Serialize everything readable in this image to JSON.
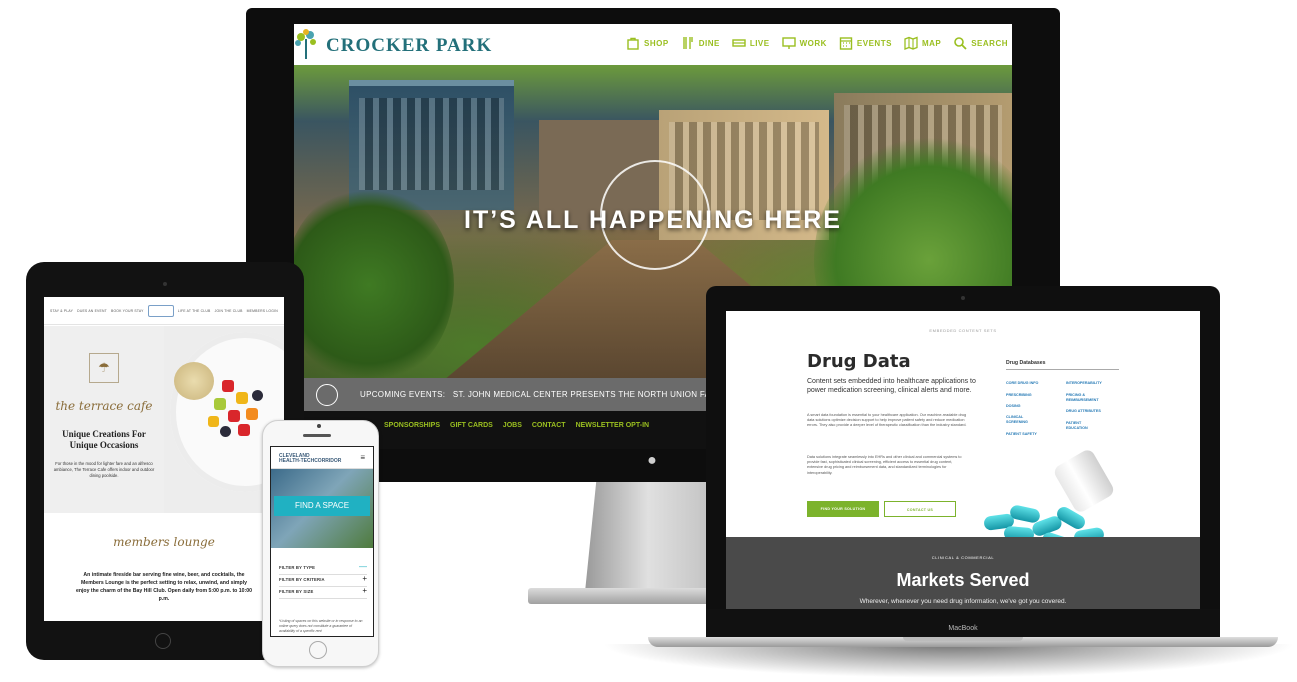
{
  "desktop": {
    "brand": "CROCKER PARK",
    "nav": [
      {
        "label": "SHOP",
        "icon": "shopping-bag-icon"
      },
      {
        "label": "DINE",
        "icon": "utensils-icon"
      },
      {
        "label": "LIVE",
        "icon": "bed-icon"
      },
      {
        "label": "WORK",
        "icon": "monitor-icon"
      },
      {
        "label": "EVENTS",
        "icon": "calendar-icon"
      },
      {
        "label": "MAP",
        "icon": "map-icon"
      },
      {
        "label": "SEARCH",
        "icon": "search-icon"
      }
    ],
    "hero_title": "IT’S ALL HAPPENING HERE",
    "events_label": "UPCOMING EVENTS:",
    "events_text": "ST. JOHN MEDICAL CENTER PRESENTS THE NORTH UNION FARMERS MARKET —",
    "footer_links": [
      "SPONSORSHIPS",
      "GIFT CARDS",
      "JOBS",
      "CONTACT",
      "NEWSLETTER OPT-IN"
    ],
    "accent_color": "#9abf20",
    "brand_color": "#23707a"
  },
  "tablet": {
    "nav": [
      "STAY & PLAY",
      "DUES AN EVENT",
      "BOOK YOUR STAY",
      "LIFE AT THE CLUB",
      "JOIN THE CLUB",
      "MEMBERS LOGIN"
    ],
    "cafe_script": "the terrace cafe",
    "cafe_heading_line1": "Unique Creations For",
    "cafe_heading_line2": "Unique Occasions",
    "cafe_body": "For those in the mood for lighter fare and an alfresco ambiance, The Terrace Cafe offers indoor and outdoor dining poolside.",
    "lounge_script": "members lounge",
    "lounge_body": "An intimate fireside bar serving fine wine, beer, and cocktails, the Members Lounge is the perfect setting to relax, unwind, and simply enjoy the charm of the Bay Hill Club. Open daily from 5:00 p.m. to 10:00 p.m.",
    "script_color": "#8a6d3a"
  },
  "phone": {
    "logo_line1": "CLEVELAND",
    "logo_line2": "HEALTH-TECH",
    "logo_line3": "CORRIDOR",
    "find_button": "FIND A SPACE",
    "filters": [
      {
        "label": "FILTER BY TYPE",
        "toggle": "—"
      },
      {
        "label": "FILTER BY CRITERIA",
        "toggle": "+"
      },
      {
        "label": "FILTER BY SIZE",
        "toggle": "+"
      }
    ],
    "note": "*Listing of spaces on this website or in response to an online query does not constitute a guarantee of availability of a specific rent",
    "accent_color": "#20b1c2"
  },
  "laptop": {
    "eyebrow": "EMBEDDED CONTENT SETS",
    "title": "Drug Data",
    "subtitle": "Content sets embedded into healthcare applications to power medication screening, clinical alerts and more.",
    "para1": "A smart data foundation is essential to your healthcare application. Our machine-readable drug data solutions optimize decision support to help improve patient safety and reduce medication errors. They also provide a deeper level of therapeutic classification than the industry standard.",
    "para2": "Data solutions integrate seamlessly into EHRs and other clinical and commercial systems to provide fast, sophisticated clinical screening, efficient access to essential drug content, extensive drug pricing and reimbursement data, and standardized terminologies for interoperability.",
    "primary_button": "FIND YOUR SOLUTION",
    "secondary_button": "CONTACT US",
    "side_title": "Drug Databases",
    "side_col1": [
      "CORE DRUG INFO",
      "PRESCRIBING",
      "DOSING",
      "CLINICAL SCREENING",
      "PATIENT SAFETY"
    ],
    "side_col2": [
      "INTEROPERABILITY",
      "PRICING & REIMBURSEMENT",
      "DRUG ATTRIBUTES",
      "PATIENT EDUCATION"
    ],
    "band_eyebrow": "CLINICAL & COMMERCIAL",
    "band_title": "Markets Served",
    "band_sub": "Wherever, whenever you need drug information, we've got you covered.",
    "brand_label": "MacBook",
    "accent_color": "#7cb32c"
  }
}
